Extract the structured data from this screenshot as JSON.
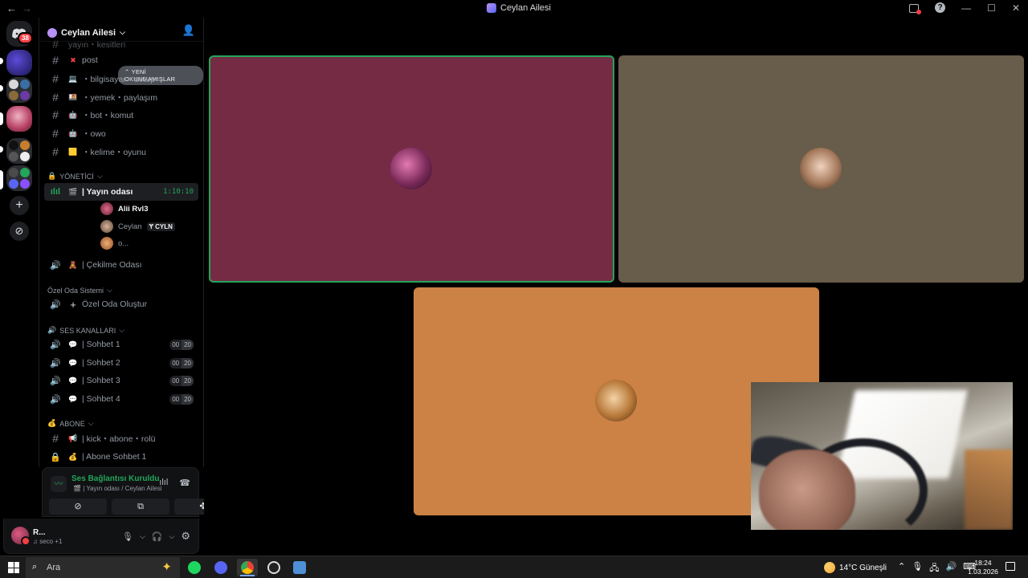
{
  "window": {
    "title": "Ceylan Ailesi"
  },
  "guild": {
    "name": "Ceylan Ailesi"
  },
  "unread_pill": "YENİ OKUNMAMIŞLAR",
  "top_fragment": "yayın・kesitleri",
  "text_channels": [
    {
      "emoji": "✖",
      "name": "post"
    },
    {
      "emoji": "💻",
      "name": "・bilgisayar・setup"
    },
    {
      "emoji": "🍱",
      "name": "・yemek・paylaşım"
    },
    {
      "emoji": "🤖",
      "name": "・bot・komut"
    },
    {
      "emoji": "🤖",
      "name": "・owo"
    },
    {
      "emoji": "🟨",
      "name": "・kelime・oyunu"
    }
  ],
  "categories": {
    "yonetici": "YÖNETİCİ",
    "ozel_oda": "Özel Oda Sistemi",
    "ses": "SES KANALLARI",
    "abone": "ABONE"
  },
  "active_voice": {
    "name": "| Yayın odası",
    "timer": "1:10:10"
  },
  "voice_users": [
    {
      "name": "Alii Rvl3",
      "tag": ""
    },
    {
      "name": "Ceylan",
      "tag": "CYLN"
    },
    {
      "name": "o...",
      "tag": ""
    }
  ],
  "cekilme": "| Çekilme Odası",
  "ozel_olustur": "Özel Oda Oluştur",
  "sohbet_channels": [
    {
      "name": "| Sohbet 1",
      "count": "00",
      "limit": "20"
    },
    {
      "name": "| Sohbet 2",
      "count": "00",
      "limit": "20"
    },
    {
      "name": "| Sohbet 3",
      "count": "00",
      "limit": "20"
    },
    {
      "name": "| Sohbet 4",
      "count": "00",
      "limit": "20"
    }
  ],
  "abone_channels": [
    {
      "name": "| kick・abone・rolü"
    },
    {
      "name": "| Abone Sohbet 1"
    }
  ],
  "voice_panel": {
    "status": "Ses Bağlantısı Kuruldu",
    "location": "| Yayın odası / Ceylan Ailesi"
  },
  "user_panel": {
    "name": "R...",
    "activity": "seco +1"
  },
  "taskbar": {
    "search_placeholder": "Ara",
    "weather": "14°C  Güneşli",
    "time": "18:24",
    "date": "1.03.2026"
  },
  "colors": {
    "tile_1": "#762b45",
    "tile_2": "#685c4a",
    "tile_3": "#cc8145",
    "speaking": "#23a55a"
  }
}
